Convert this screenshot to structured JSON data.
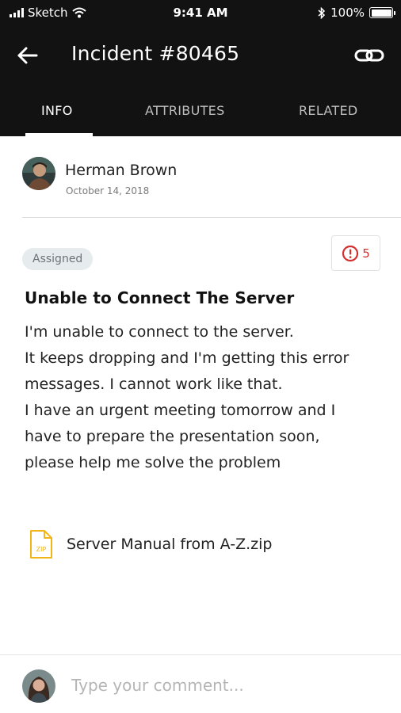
{
  "status_bar": {
    "carrier": "Sketch",
    "time": "9:41 AM",
    "battery": "100%",
    "icons": [
      "signal-icon",
      "wifi-icon",
      "bluetooth-icon",
      "battery-icon"
    ]
  },
  "header": {
    "title": "Incident #80465",
    "icons": [
      "back-arrow-icon",
      "link-icon"
    ],
    "background": "#121212"
  },
  "tabs": [
    {
      "label": "INFO",
      "active": true
    },
    {
      "label": "ATTRIBUTES",
      "active": false
    },
    {
      "label": "RELATED",
      "active": false
    }
  ],
  "author": {
    "name": "Herman Brown",
    "date": "October 14, 2018"
  },
  "incident": {
    "status": "Assigned",
    "priority_count": "5",
    "priority_color": "#d32f2f",
    "title": "Unable to Connect The Server",
    "description_lines": [
      "I'm unable to connect to the server.",
      "It keeps dropping and I'm getting this error",
      "messages. I cannot work like that.",
      "I have an urgent meeting tomorrow and I",
      "have to prepare the presentation soon,",
      "please help me solve the problem"
    ]
  },
  "attachment": {
    "icon_label": "ZIP",
    "name": "Server Manual from A-Z.zip",
    "icon_color": "#f2b416"
  },
  "comment": {
    "placeholder": "Type your comment..."
  }
}
